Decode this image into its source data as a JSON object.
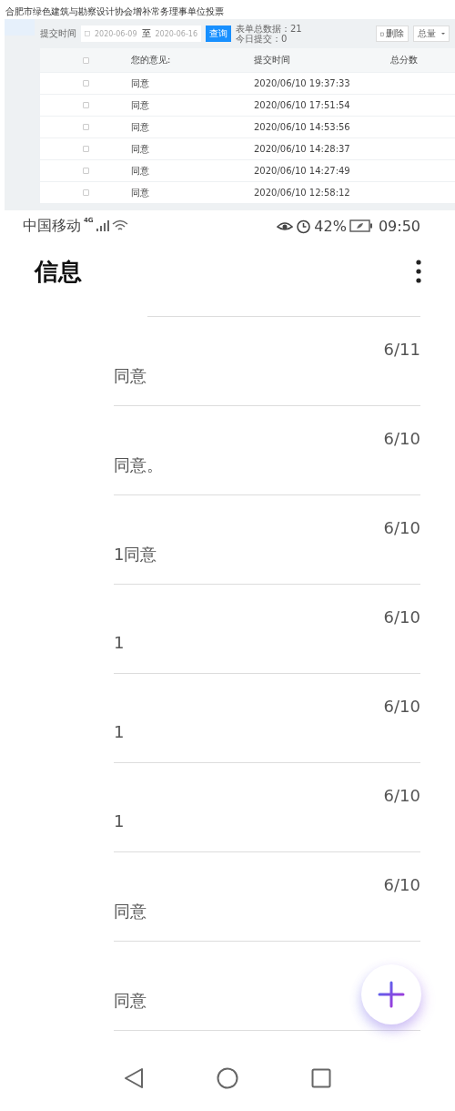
{
  "web_page": {
    "title": "合肥市绿色建筑与勘察设计协会增补常务理事单位投票",
    "filter": {
      "label": "提交时间",
      "start_date": "2020-06-09",
      "separator": "至",
      "end_date": "2020-06-16",
      "query_button": "查询",
      "total": "表单总数据：21",
      "today": "今日提交：0",
      "delete_button": "删除",
      "select_value": "总量"
    },
    "table": {
      "select_all_checked": false,
      "columns": [
        "您的意见:",
        "提交时间",
        "总分数"
      ],
      "rows": [
        {
          "checked": false,
          "opinion": "同意",
          "time": "2020/06/10 19:37:33"
        },
        {
          "checked": false,
          "opinion": "同意",
          "time": "2020/06/10 17:51:54"
        },
        {
          "checked": false,
          "opinion": "同意",
          "time": "2020/06/10 14:53:56"
        },
        {
          "checked": false,
          "opinion": "同意",
          "time": "2020/06/10 14:28:37"
        },
        {
          "checked": false,
          "opinion": "同意",
          "time": "2020/06/10 14:27:49"
        },
        {
          "checked": false,
          "opinion": "同意",
          "time": "2020/06/10 12:58:12"
        }
      ]
    }
  },
  "status_bar": {
    "carrier": "中国移动",
    "network": "4G",
    "battery": "42%",
    "time": "09:50"
  },
  "app": {
    "title": "信息",
    "messages": [
      {
        "date": "6/11",
        "text": "同意"
      },
      {
        "date": "6/10",
        "text": "同意。"
      },
      {
        "date": "6/10",
        "text": "1同意"
      },
      {
        "date": "6/10",
        "text": "1"
      },
      {
        "date": "6/10",
        "text": "1"
      },
      {
        "date": "6/10",
        "text": "1"
      },
      {
        "date": "6/10",
        "text": "同意"
      },
      {
        "text": "同意"
      }
    ]
  }
}
